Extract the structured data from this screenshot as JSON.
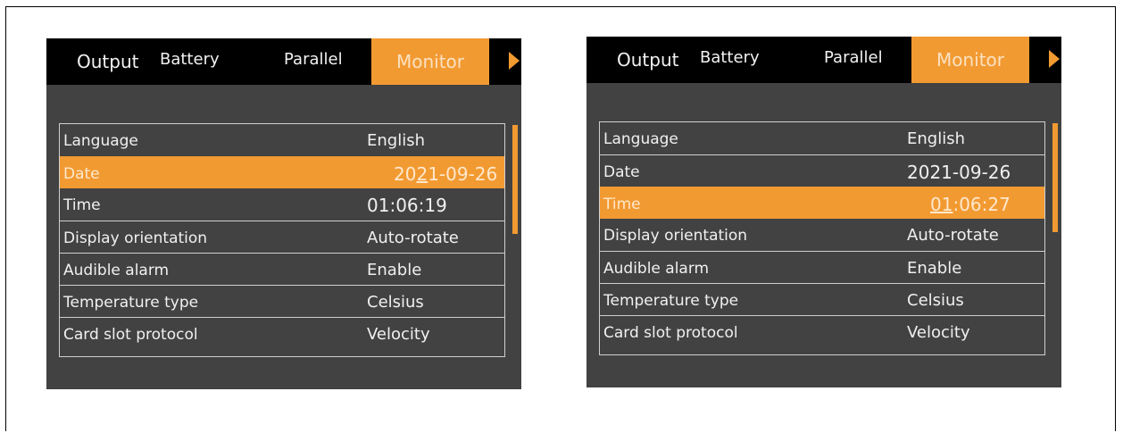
{
  "tabs": {
    "output": "Output",
    "battery": "Battery",
    "parallel": "Parallel",
    "monitor": "Monitor"
  },
  "labels": {
    "language": "Language",
    "date": "Date",
    "time": "Time",
    "display_orientation": "Display orientation",
    "audible_alarm": "Audible alarm",
    "temperature_type": "Temperature type",
    "card_slot_protocol": "Card slot protocol"
  },
  "values": {
    "language": "English",
    "display_orientation": "Auto-rotate",
    "audible_alarm": "Enable",
    "temperature_type": "Celsius",
    "card_slot_protocol": "Velocity"
  },
  "left": {
    "selected_row": "Date",
    "date_pre": "20",
    "date_cursor": "2",
    "date_post": "1-09-26",
    "time": "01:06:19"
  },
  "right": {
    "selected_row": "Time",
    "date": "2021-09-26",
    "time_pre": "",
    "time_cursor": "01",
    "time_post": ":06:27"
  },
  "colors": {
    "accent": "#f29a32",
    "screen_bg": "#424242",
    "tabbar_bg": "#000000"
  },
  "icons": {
    "tab_scroll_arrow": "triangle-right"
  }
}
